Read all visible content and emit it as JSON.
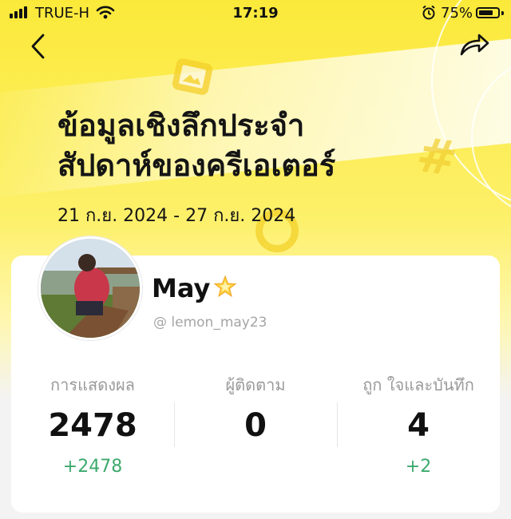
{
  "status_bar": {
    "carrier": "TRUE-H",
    "time": "17:19",
    "battery": "75%",
    "battery_level": 0.75
  },
  "header": {
    "title_line1": "ข้อมูลเชิงลึกประจำ",
    "title_line2": "สัปดาห์ของครีเอเตอร์",
    "date_range": "21 ก.ย. 2024 - 27 ก.ย. 2024"
  },
  "profile": {
    "name": "May",
    "name_emoji": "🌟",
    "handle": "@ lemon_may23"
  },
  "stats": [
    {
      "label": "การแสดงผล",
      "value": "2478",
      "delta": "+2478"
    },
    {
      "label": "ผู้ติดตาม",
      "value": "0",
      "delta": ""
    },
    {
      "label": "ถูก ใจและบันทึก",
      "value": "4",
      "delta": "+2"
    }
  ],
  "colors": {
    "accent_yellow": "#fbe93a",
    "delta_green": "#3daa6d"
  }
}
